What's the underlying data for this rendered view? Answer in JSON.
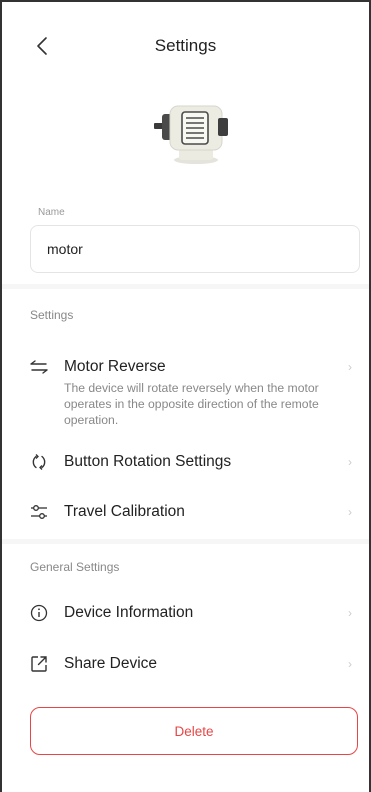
{
  "header": {
    "title": "Settings"
  },
  "device": {
    "image": "motor-device-icon"
  },
  "name": {
    "label": "Name",
    "value": "motor"
  },
  "settings": {
    "section_label": "Settings",
    "items": [
      {
        "label": "Motor Reverse",
        "icon": "reverse-arrows-icon",
        "description": "The device will rotate reversely when the motor operates in the opposite direction of the remote operation."
      },
      {
        "label": "Button Rotation Settings",
        "icon": "rotation-icon"
      },
      {
        "label": "Travel Calibration",
        "icon": "calibration-slider-icon"
      }
    ]
  },
  "general": {
    "section_label": "General Settings",
    "items": [
      {
        "label": "Device Information",
        "icon": "info-icon"
      },
      {
        "label": "Share Device",
        "icon": "share-icon"
      }
    ]
  },
  "actions": {
    "delete_label": "Delete"
  },
  "colors": {
    "danger": "#e84646",
    "text": "#222222",
    "muted": "#888888"
  }
}
